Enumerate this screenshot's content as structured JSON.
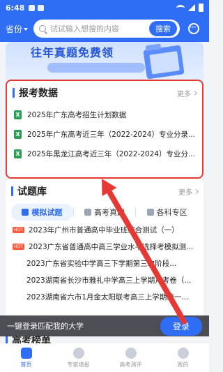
{
  "status": {
    "time": "6:48"
  },
  "header": {
    "province": "省份",
    "search_placeholder": "试试输入想搜的内容",
    "search_button": "搜索"
  },
  "banner": {
    "title": "往年真题免费领"
  },
  "report": {
    "title": "报考数据",
    "more": "更多",
    "items": [
      "2025年广东高考招生计划数据",
      "2025年广东高考近三年（2022-2024）专业分录...",
      "2025年黑龙江高考近三年（2022-2024）专业分..."
    ]
  },
  "exam": {
    "title": "试题库",
    "more": "更多",
    "tabs": [
      "模拟试题",
      "高考真题",
      "各科专区"
    ],
    "hot_label": "HOT",
    "items": [
      "2023年广州市普通高中毕业班综合测试（一）",
      "2023广东省普通高中高三学业水平选择考模拟测...",
      "2023广东省实验中学高三下学期第三次阶段...",
      "2023湖南省长沙市雅礼中学高三上学期月考卷（...",
      "2023湖南省六市1月金太阳联考高三上学期统一..."
    ]
  },
  "rank": {
    "title": "高考榜单"
  },
  "login_bar": {
    "text": "一键登录匹配我的大学",
    "button": "登录"
  },
  "tabbar": {
    "items": [
      "首页",
      "专家填报",
      "高考测评",
      "我的"
    ]
  },
  "colors": {
    "primary": "#2f6df6",
    "highlight": "#e53935",
    "excel": "#2e9e57",
    "hot": "#ff5a3a"
  }
}
